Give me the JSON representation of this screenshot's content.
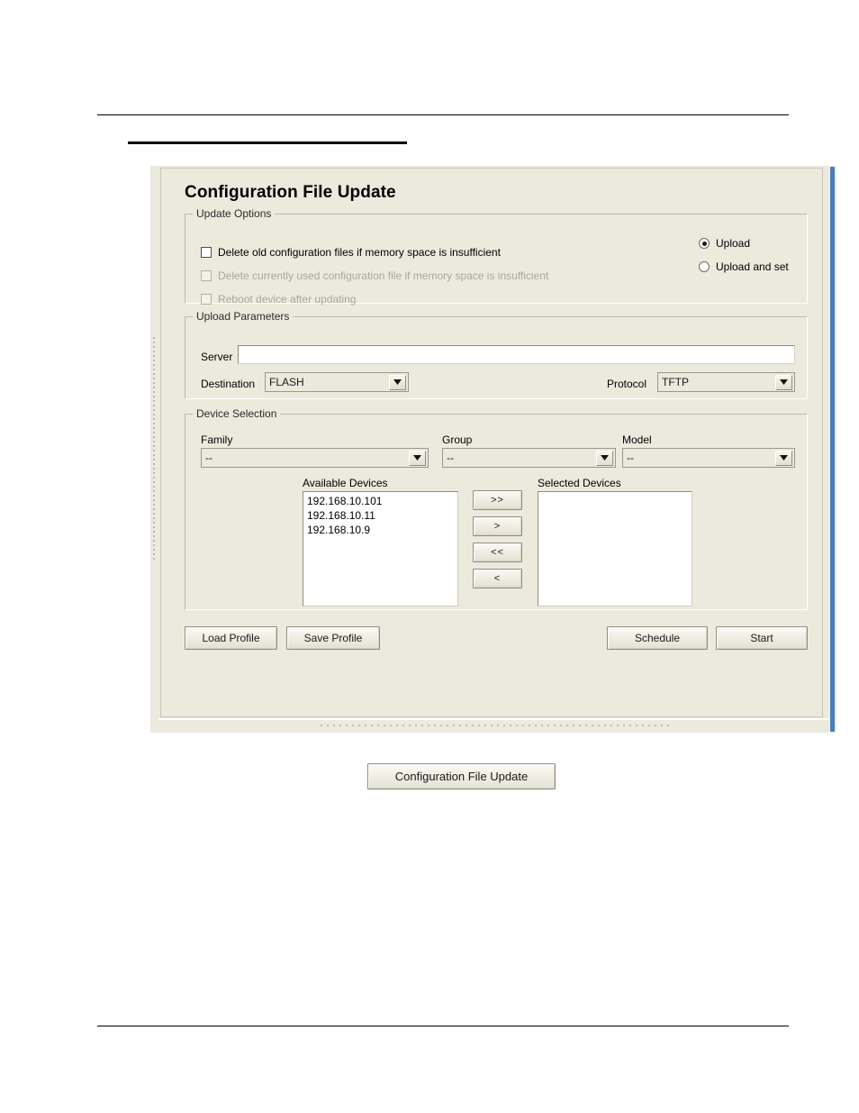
{
  "dialog": {
    "title": "Configuration File Update"
  },
  "update_options": {
    "legend": "Update Options",
    "checkboxes": [
      {
        "label": "Delete old configuration files if memory space is insufficient",
        "checked": false,
        "enabled": true
      },
      {
        "label": "Delete currently used configuration file if memory space is insufficient",
        "checked": false,
        "enabled": false
      },
      {
        "label": "Reboot device after updating",
        "checked": false,
        "enabled": false
      }
    ],
    "radios": [
      {
        "label": "Upload",
        "selected": true
      },
      {
        "label": "Upload and set",
        "selected": false
      }
    ]
  },
  "upload_parameters": {
    "legend": "Upload Parameters",
    "server_label": "Server",
    "server_value": "",
    "destination_label": "Destination",
    "destination_value": "FLASH",
    "protocol_label": "Protocol",
    "protocol_value": "TFTP"
  },
  "device_selection": {
    "legend": "Device Selection",
    "family_label": "Family",
    "family_value": "--",
    "group_label": "Group",
    "group_value": "--",
    "model_label": "Model",
    "model_value": "--",
    "available_caption": "Available Devices",
    "available_devices": [
      "192.168.10.101",
      "192.168.10.11",
      "192.168.10.9"
    ],
    "selected_caption": "Selected Devices",
    "selected_devices": [],
    "transfer_buttons": [
      {
        "label": ">>",
        "name": "move-all-right-button"
      },
      {
        "label": ">",
        "name": "move-right-button"
      },
      {
        "label": "<<",
        "name": "move-all-left-button"
      },
      {
        "label": "<",
        "name": "move-left-button"
      }
    ]
  },
  "action_buttons": {
    "load_profile": "Load Profile",
    "save_profile": "Save Profile",
    "schedule": "Schedule",
    "start": "Start"
  },
  "caption": {
    "button_label": "Configuration File Update"
  },
  "colors": {
    "panel_background": "#ece9dd",
    "scrollbar_accent": "#4a7ebb",
    "disabled_text": "#a9a69c"
  }
}
